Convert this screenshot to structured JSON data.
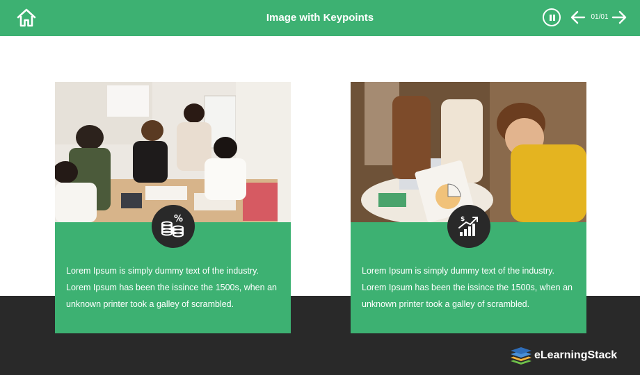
{
  "header": {
    "title": "Image with Keypoints",
    "counter": "01/01",
    "icons": {
      "home": "home-icon",
      "pause": "pause-icon",
      "prev": "arrow-left-icon",
      "next": "arrow-right-icon"
    }
  },
  "cards": [
    {
      "icon": "coins-percent-icon",
      "text": "Lorem Ipsum is simply dummy text of the industry. Lorem Ipsum has been the issince the 1500s, when an unknown printer took a galley of scrambled."
    },
    {
      "icon": "growth-chart-icon",
      "text": "Lorem Ipsum is simply dummy text of the industry. Lorem Ipsum has been the issince the 1500s, when an unknown printer took a galley of scrambled."
    }
  ],
  "brand": {
    "name": "eLearningStack"
  },
  "colors": {
    "accent": "#3db172",
    "dark": "#292929",
    "white": "#ffffff"
  }
}
